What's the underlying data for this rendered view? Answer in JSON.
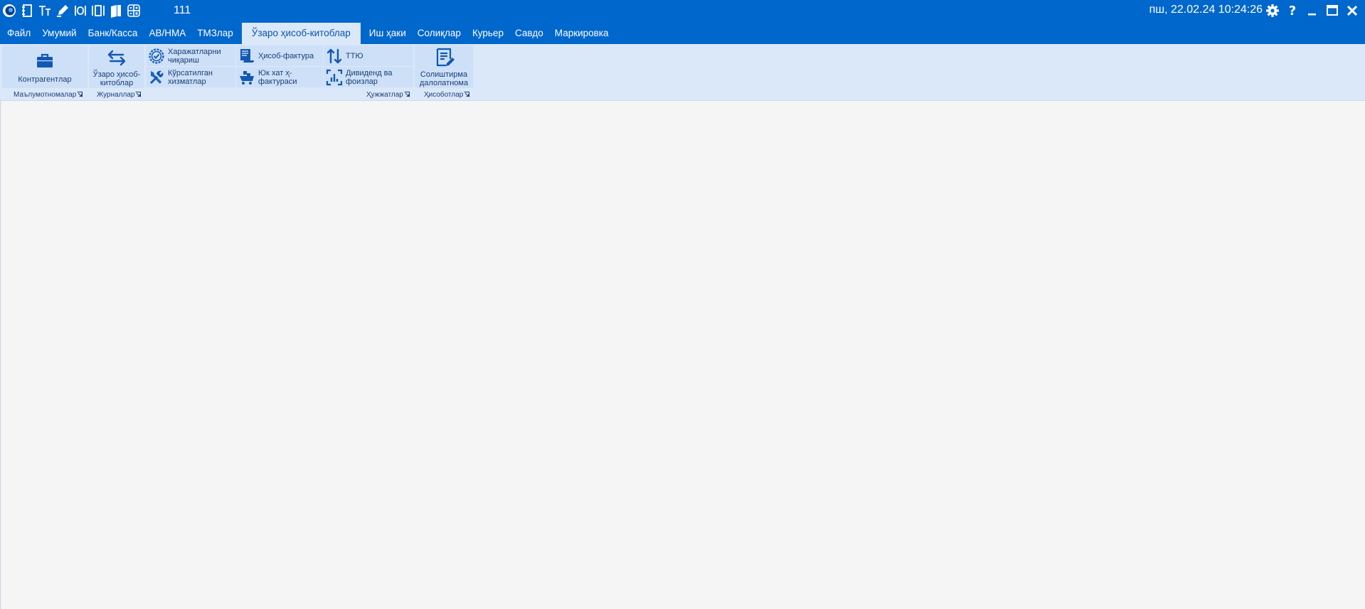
{
  "titlebar": {
    "number": "111",
    "datetime": "пш, 22.02.24 10:24:26"
  },
  "menu": {
    "tabs": [
      {
        "label": "Файл"
      },
      {
        "label": "Умумий"
      },
      {
        "label": "Банк/Касса"
      },
      {
        "label": "АВ/НМА"
      },
      {
        "label": "ТМЗлар"
      },
      {
        "label": "Ўзаро ҳисоб-китоблар",
        "active": true
      },
      {
        "label": "Иш ҳаки"
      },
      {
        "label": "Солиқлар"
      },
      {
        "label": "Курьер"
      },
      {
        "label": "Савдо"
      },
      {
        "label": "Маркировка"
      }
    ]
  },
  "ribbon": {
    "groups": {
      "references": "Маълумотномалар",
      "journals": "Журналлар",
      "documents": "Ҳужжатлар",
      "reports": "Ҳисоботлар"
    },
    "buttons": {
      "contragents": "Контрагентлар",
      "mutual_line1": "Ўзаро ҳисоб-",
      "mutual_line2": "китоблар",
      "expenses_line1": "Харажатларни",
      "expenses_line2": "чиқариш",
      "services_line1": "Кўрсатилган",
      "services_line2": "хизматлар",
      "invoice": "Ҳисоб-фактура",
      "waybill_line1": "Юк хат ҳ-",
      "waybill_line2": "фактураси",
      "ttu": "ТТЮ",
      "dividend_line1": "Дивиденд ва",
      "dividend_line2": "фоизлар",
      "reconcile_line1": "Солиштирма",
      "reconcile_line2": "далолатнома"
    }
  },
  "colors": {
    "titlebar": "#0067cc",
    "ribbon": "#dbe8f9",
    "button": "#cde0f8",
    "icon": "#1258b4"
  }
}
